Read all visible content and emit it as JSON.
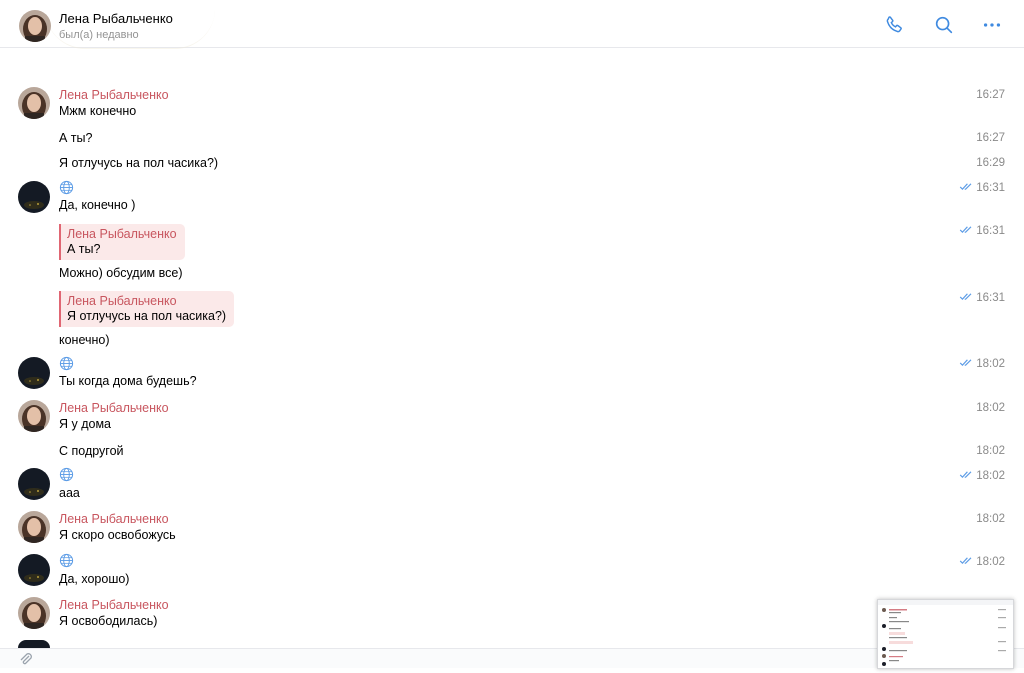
{
  "header": {
    "name": "Лена Рыбальченко",
    "status": "был(а) недавно",
    "icons": [
      "phone-icon",
      "search-icon",
      "more-icon"
    ]
  },
  "messages": [
    {
      "author": "Лена Рыбальченко",
      "text": "Мжм конечно",
      "time": "16:27"
    },
    {
      "text": "А ты?",
      "time": "16:27"
    },
    {
      "text": "Я отлучусь на пол часика?)",
      "time": "16:29"
    },
    {
      "author_icon": "globe-icon",
      "text": "Да, конечно )",
      "time": "16:31",
      "read": true
    },
    {
      "reply": {
        "name": "Лена Рыбальченко",
        "text": "А ты?"
      },
      "text": "Можно) обсудим все)",
      "time": "16:31",
      "read": true
    },
    {
      "reply": {
        "name": "Лена Рыбальченко",
        "text": "Я отлучусь на пол часика?)"
      },
      "text": "конечно)",
      "time": "16:31",
      "read": true
    },
    {
      "author_icon": "globe-icon",
      "text": "Ты когда дома будешь?",
      "time": "18:02",
      "read": true
    },
    {
      "author": "Лена Рыбальченко",
      "text": "Я у дома",
      "time": "18:02"
    },
    {
      "text": "С подругой",
      "time": "18:02"
    },
    {
      "author_icon": "globe-icon",
      "text": "ааа",
      "time": "18:02",
      "read": true
    },
    {
      "author": "Лена Рыбальченко",
      "text": "Я скоро освобожусь",
      "time": "18:02"
    },
    {
      "author_icon": "globe-icon",
      "text": "Да, хорошо)",
      "time": "18:02",
      "read": true
    },
    {
      "author": "Лена Рыбальченко",
      "text": "Я освободилась)",
      "time": ""
    }
  ],
  "colors": {
    "author": "#c8565f",
    "reply_bg": "#fbe9e9",
    "reply_bar": "#e06673",
    "accent": "#2a5885",
    "time": "#8a8a8a"
  }
}
